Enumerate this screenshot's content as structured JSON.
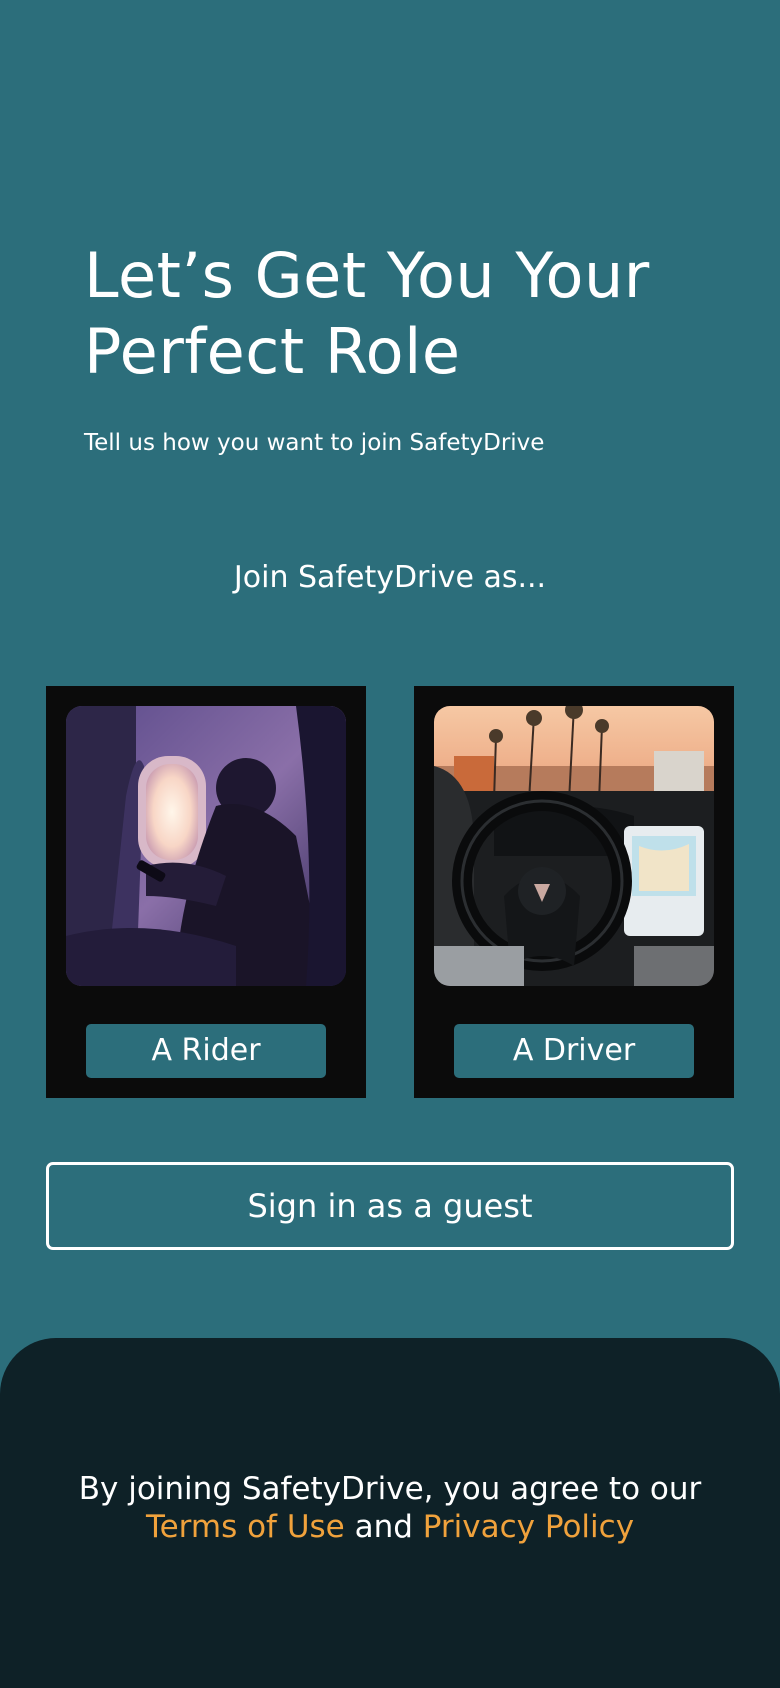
{
  "header": {
    "title": "Let’s Get You Your Perfect Role",
    "subtitle": "Tell us how you want to join SafetyDrive"
  },
  "roles": {
    "prompt": "Join SafetyDrive as...",
    "rider": {
      "label": "A Rider",
      "image_icon": "airplane-passenger-photo"
    },
    "driver": {
      "label": "A Driver",
      "image_icon": "car-steering-wheel-photo"
    }
  },
  "guest": {
    "label": "Sign in as a guest"
  },
  "footer": {
    "legal_prefix": "By joining SafetyDrive, you agree to our",
    "terms_link": "Terms of Use",
    "conjunction": "and",
    "privacy_link": "Privacy Policy"
  },
  "colors": {
    "background": "#2c6e7b",
    "card": "#0b0b0b",
    "footer": "#0e2127",
    "link": "#f0a23c",
    "text": "#ffffff"
  }
}
